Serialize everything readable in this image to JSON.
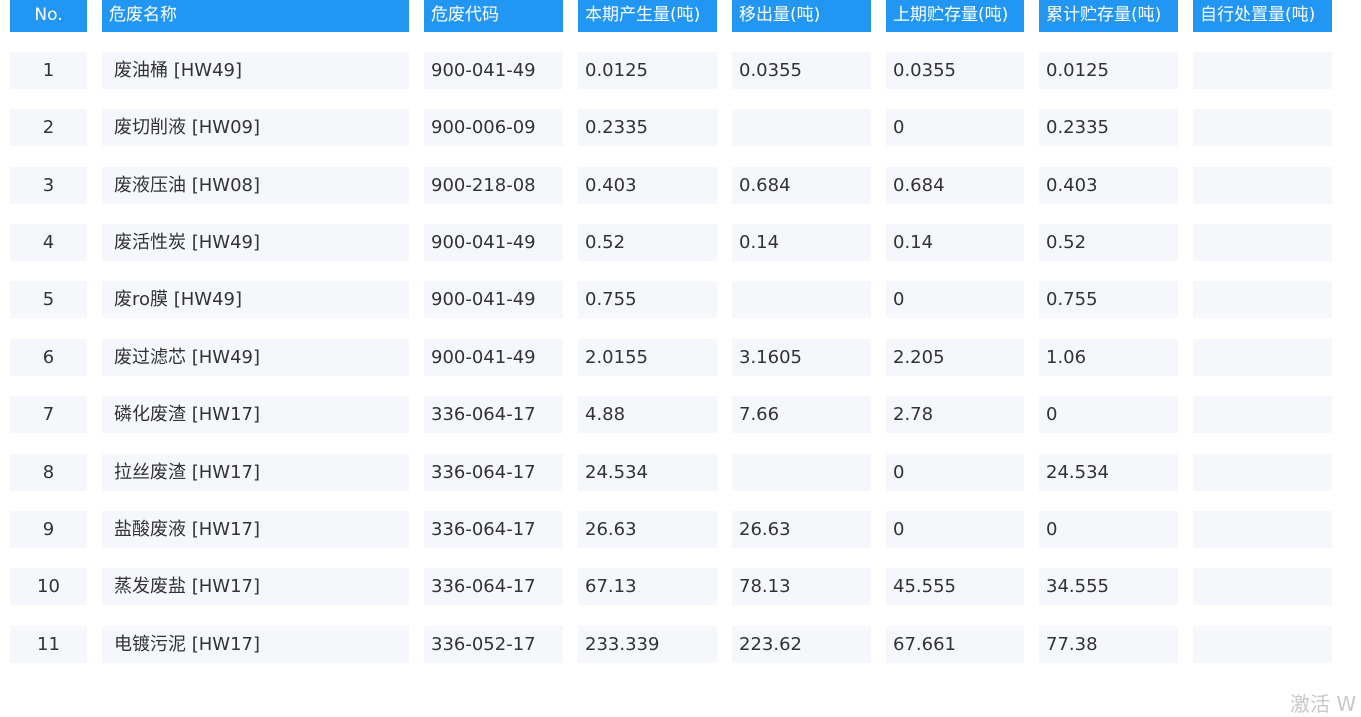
{
  "columns": [
    "No.",
    "危废名称",
    "危废代码",
    "本期产生量(吨)",
    "移出量(吨)",
    "上期贮存量(吨)",
    "累计贮存量(吨)",
    "自行处置量(吨)"
  ],
  "rows": [
    [
      "1",
      "废油桶 [HW49]",
      "900-041-49",
      "0.0125",
      "0.0355",
      "0.0355",
      "0.0125",
      ""
    ],
    [
      "2",
      "废切削液 [HW09]",
      "900-006-09",
      "0.2335",
      "",
      "0",
      "0.2335",
      ""
    ],
    [
      "3",
      "废液压油 [HW08]",
      "900-218-08",
      "0.403",
      "0.684",
      "0.684",
      "0.403",
      ""
    ],
    [
      "4",
      "废活性炭 [HW49]",
      "900-041-49",
      "0.52",
      "0.14",
      "0.14",
      "0.52",
      ""
    ],
    [
      "5",
      "废ro膜 [HW49]",
      "900-041-49",
      "0.755",
      "",
      "0",
      "0.755",
      ""
    ],
    [
      "6",
      "废过滤芯 [HW49]",
      "900-041-49",
      "2.0155",
      "3.1605",
      "2.205",
      "1.06",
      ""
    ],
    [
      "7",
      "磷化废渣 [HW17]",
      "336-064-17",
      "4.88",
      "7.66",
      "2.78",
      "0",
      ""
    ],
    [
      "8",
      "拉丝废渣 [HW17]",
      "336-064-17",
      "24.534",
      "",
      "0",
      "24.534",
      ""
    ],
    [
      "9",
      "盐酸废液 [HW17]",
      "336-064-17",
      "26.63",
      "26.63",
      "0",
      "0",
      ""
    ],
    [
      "10",
      "蒸发废盐 [HW17]",
      "336-064-17",
      "67.13",
      "78.13",
      "45.555",
      "34.555",
      ""
    ],
    [
      "11",
      "电镀污泥 [HW17]",
      "336-052-17",
      "233.339",
      "223.62",
      "67.661",
      "77.38",
      ""
    ]
  ],
  "watermark": "激活 W",
  "colors": {
    "header_bg": "#2196f3",
    "header_text": "#ffffff",
    "cell_bg": "#f5f7fa",
    "cell_text": "#333333"
  }
}
